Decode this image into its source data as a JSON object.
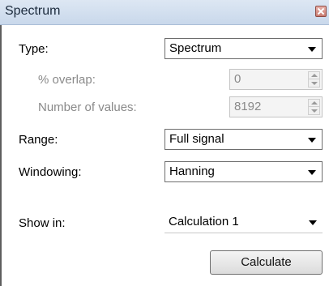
{
  "window": {
    "title": "Spectrum"
  },
  "form": {
    "type": {
      "label": "Type:",
      "value": "Spectrum"
    },
    "overlap": {
      "label": "% overlap:",
      "value": "0"
    },
    "num_values": {
      "label": "Number of values:",
      "value": "8192"
    },
    "range": {
      "label": "Range:",
      "value": "Full signal"
    },
    "windowing": {
      "label": "Windowing:",
      "value": "Hanning"
    },
    "show_in": {
      "label": "Show in:",
      "value": "Calculation 1"
    }
  },
  "actions": {
    "calculate_label": "Calculate"
  },
  "icons": {
    "close": "close-icon",
    "dropdown": "chevron-down-icon",
    "spin": "spin-arrows-icon"
  }
}
